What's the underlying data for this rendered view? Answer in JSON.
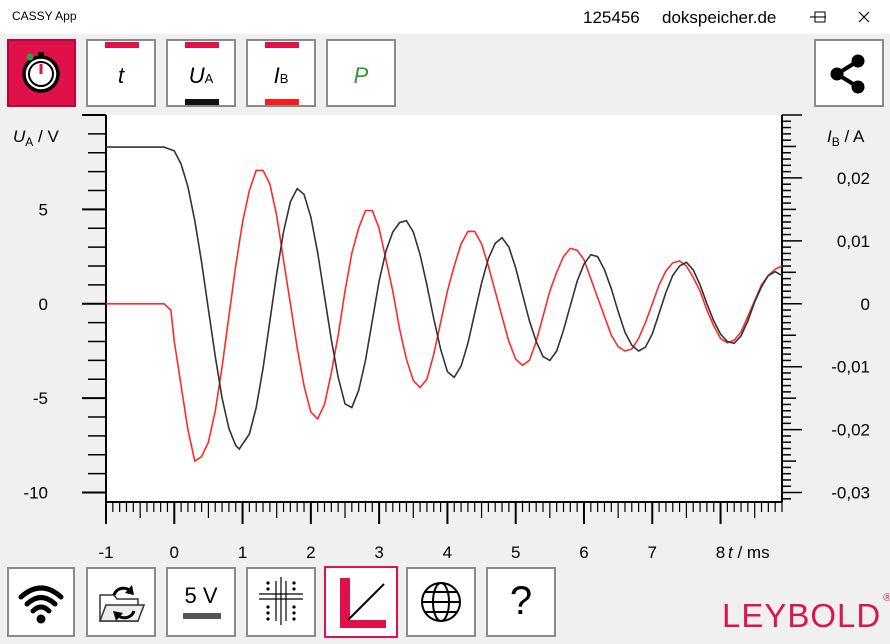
{
  "window": {
    "title": "CASSY App",
    "serial": "125456",
    "site": "dokspeicher.de"
  },
  "toolbar": {
    "channels": [
      {
        "name": "t",
        "sub": ""
      },
      {
        "name": "U",
        "sub": "A"
      },
      {
        "name": "I",
        "sub": "B"
      },
      {
        "name": "P",
        "sub": ""
      }
    ],
    "colors": {
      "active": "#e0104a",
      "voltage": "#111111",
      "current": "#ff1a1a",
      "power": "#2a9a2a"
    },
    "icons": [
      "stopwatch-icon",
      "share-icon"
    ]
  },
  "bottom_toolbar": {
    "voltage_range": "5 V",
    "help": "?",
    "icons": [
      "wifi-icon",
      "open-folder-refresh-icon",
      "voltage-range-icon",
      "grid-settings-icon",
      "diagram-icon",
      "globe-icon",
      "help-icon"
    ]
  },
  "brand": {
    "name": "LEYBOLD",
    "mark": "®"
  },
  "chart_data": {
    "type": "line",
    "xlabel": {
      "var": "t",
      "unit": "ms"
    },
    "ylabel_left": {
      "var": "U",
      "sub": "A",
      "unit": "V"
    },
    "ylabel_right": {
      "var": "I",
      "sub": "B",
      "unit": "A"
    },
    "xlim": [
      -1,
      8.9
    ],
    "ylim_left": [
      -10.5,
      10
    ],
    "ylim_right": [
      -0.0315,
      0.03
    ],
    "x_ticks": [
      "-1",
      "0",
      "1",
      "2",
      "3",
      "4",
      "5",
      "6",
      "7",
      "8"
    ],
    "y_left_ticks": [
      "5",
      "0",
      "-5",
      "-10"
    ],
    "y_right_ticks": [
      "0,02",
      "0,01",
      "0",
      "-0,01",
      "-0,02",
      "-0,03"
    ],
    "series": [
      {
        "color": "#333333",
        "x": [
          -1.0,
          -0.5,
          -0.15,
          0.0,
          0.1,
          0.2,
          0.3,
          0.4,
          0.5,
          0.6,
          0.7,
          0.8,
          0.9,
          0.95,
          1.1,
          1.2,
          1.3,
          1.4,
          1.5,
          1.6,
          1.7,
          1.8,
          1.9,
          2.0,
          2.1,
          2.2,
          2.3,
          2.4,
          2.5,
          2.6,
          2.7,
          2.8,
          2.9,
          3.0,
          3.1,
          3.2,
          3.3,
          3.4,
          3.5,
          3.6,
          3.7,
          3.8,
          3.9,
          4.0,
          4.1,
          4.2,
          4.3,
          4.4,
          4.5,
          4.6,
          4.7,
          4.8,
          4.9,
          5.0,
          5.1,
          5.2,
          5.3,
          5.4,
          5.5,
          5.6,
          5.7,
          5.8,
          5.9,
          6.0,
          6.1,
          6.2,
          6.3,
          6.4,
          6.5,
          6.6,
          6.7,
          6.8,
          6.9,
          7.0,
          7.1,
          7.2,
          7.3,
          7.4,
          7.5,
          7.6,
          7.7,
          7.8,
          7.9,
          8.0,
          8.1,
          8.2,
          8.3,
          8.4,
          8.5,
          8.6,
          8.7,
          8.8,
          8.9
        ],
        "values": [
          8.3,
          8.3,
          8.3,
          8.1,
          7.4,
          6.2,
          4.4,
          2.2,
          -0.3,
          -2.8,
          -5.0,
          -6.6,
          -7.5,
          -7.7,
          -6.9,
          -5.5,
          -3.4,
          -0.9,
          1.6,
          3.8,
          5.4,
          6.1,
          5.8,
          4.6,
          2.7,
          0.4,
          -1.9,
          -3.9,
          -5.3,
          -5.5,
          -4.6,
          -3.0,
          -0.9,
          1.2,
          2.8,
          3.8,
          4.3,
          4.4,
          3.8,
          2.6,
          1.0,
          -0.8,
          -2.4,
          -3.6,
          -3.9,
          -3.3,
          -2.1,
          -0.5,
          1.1,
          2.4,
          3.2,
          3.5,
          3.0,
          1.9,
          0.5,
          -0.9,
          -2.0,
          -2.8,
          -3.0,
          -2.5,
          -1.4,
          -0.1,
          1.2,
          2.1,
          2.6,
          2.5,
          1.8,
          0.8,
          -0.4,
          -1.5,
          -2.2,
          -2.5,
          -2.3,
          -1.6,
          -0.5,
          0.6,
          1.5,
          2.0,
          2.2,
          1.8,
          1.0,
          0.0,
          -0.9,
          -1.6,
          -2.0,
          -2.1,
          -1.7,
          -0.9,
          0.1,
          0.9,
          1.5,
          1.7,
          1.5
        ]
      },
      {
        "color": "#ff2a2a",
        "x": [
          -1.0,
          -0.5,
          -0.15,
          -0.05,
          0.0,
          0.1,
          0.2,
          0.3,
          0.4,
          0.5,
          0.6,
          0.7,
          0.8,
          0.9,
          1.0,
          1.1,
          1.2,
          1.3,
          1.4,
          1.5,
          1.6,
          1.7,
          1.8,
          1.9,
          2.0,
          2.1,
          2.2,
          2.3,
          2.4,
          2.5,
          2.6,
          2.7,
          2.8,
          2.9,
          3.0,
          3.1,
          3.2,
          3.3,
          3.4,
          3.5,
          3.6,
          3.7,
          3.8,
          3.9,
          4.0,
          4.1,
          4.2,
          4.3,
          4.4,
          4.5,
          4.6,
          4.7,
          4.8,
          4.9,
          5.0,
          5.1,
          5.2,
          5.3,
          5.4,
          5.5,
          5.6,
          5.7,
          5.8,
          5.9,
          6.0,
          6.1,
          6.2,
          6.3,
          6.4,
          6.5,
          6.6,
          6.7,
          6.8,
          6.9,
          7.0,
          7.1,
          7.2,
          7.3,
          7.4,
          7.5,
          7.6,
          7.7,
          7.8,
          7.9,
          8.0,
          8.1,
          8.2,
          8.3,
          8.4,
          8.5,
          8.6,
          8.7,
          8.8,
          8.9
        ],
        "values": [
          0.0,
          0.0,
          0.0,
          -0.001,
          -0.006,
          -0.013,
          -0.02,
          -0.025,
          -0.0243,
          -0.022,
          -0.017,
          -0.01,
          -0.002,
          0.006,
          0.013,
          0.018,
          0.0212,
          0.0212,
          0.019,
          0.014,
          0.007,
          0.0,
          -0.007,
          -0.013,
          -0.0172,
          -0.0183,
          -0.016,
          -0.011,
          -0.005,
          0.002,
          0.008,
          0.012,
          0.0148,
          0.0148,
          0.012,
          0.007,
          0.002,
          -0.004,
          -0.0088,
          -0.0122,
          -0.0133,
          -0.012,
          -0.008,
          -0.003,
          0.002,
          0.006,
          0.0095,
          0.0115,
          0.0115,
          0.0095,
          0.006,
          0.002,
          -0.002,
          -0.006,
          -0.0088,
          -0.0098,
          -0.009,
          -0.006,
          -0.002,
          0.002,
          0.005,
          0.0075,
          0.0088,
          0.0085,
          0.007,
          0.004,
          0.001,
          -0.002,
          -0.005,
          -0.0068,
          -0.0075,
          -0.0072,
          -0.0055,
          -0.003,
          0.0,
          0.003,
          0.0052,
          0.0065,
          0.0068,
          0.006,
          0.0042,
          0.002,
          -0.001,
          -0.0035,
          -0.0055,
          -0.0062,
          -0.0058,
          -0.0045,
          -0.002,
          0.0005,
          0.003,
          0.0045,
          0.0055,
          0.006
        ]
      }
    ]
  }
}
